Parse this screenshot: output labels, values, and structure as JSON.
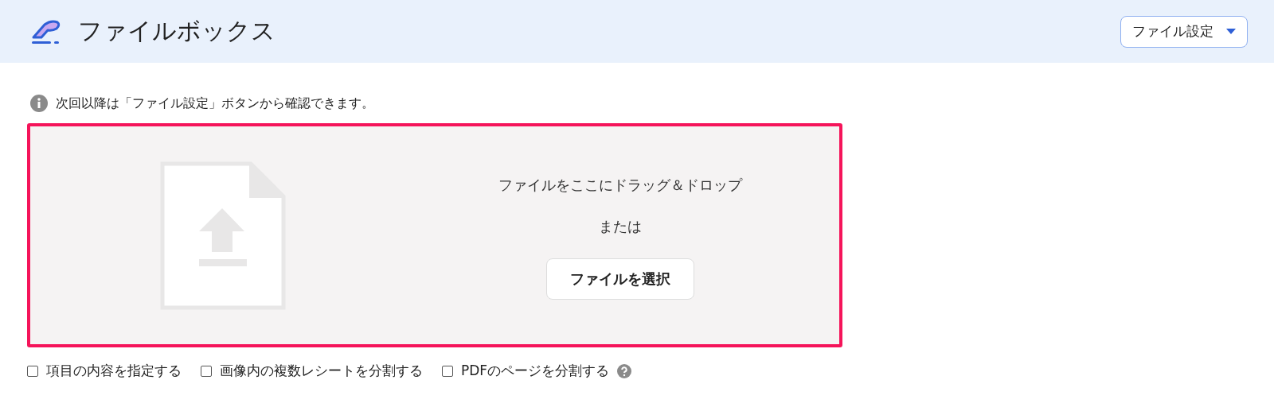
{
  "header": {
    "title": "ファイルボックス",
    "settings_button": "ファイル設定"
  },
  "info": "次回以降は「ファイル設定」ボタンから確認できます。",
  "dropzone": {
    "instruction": "ファイルをここにドラッグ＆ドロップ",
    "or": "または",
    "button": "ファイルを選択"
  },
  "options": [
    {
      "label": "項目の内容を指定する",
      "checked": false,
      "help": false
    },
    {
      "label": "画像内の複数レシートを分割する",
      "checked": false,
      "help": false
    },
    {
      "label": "PDFのページを分割する",
      "checked": false,
      "help": true
    }
  ]
}
